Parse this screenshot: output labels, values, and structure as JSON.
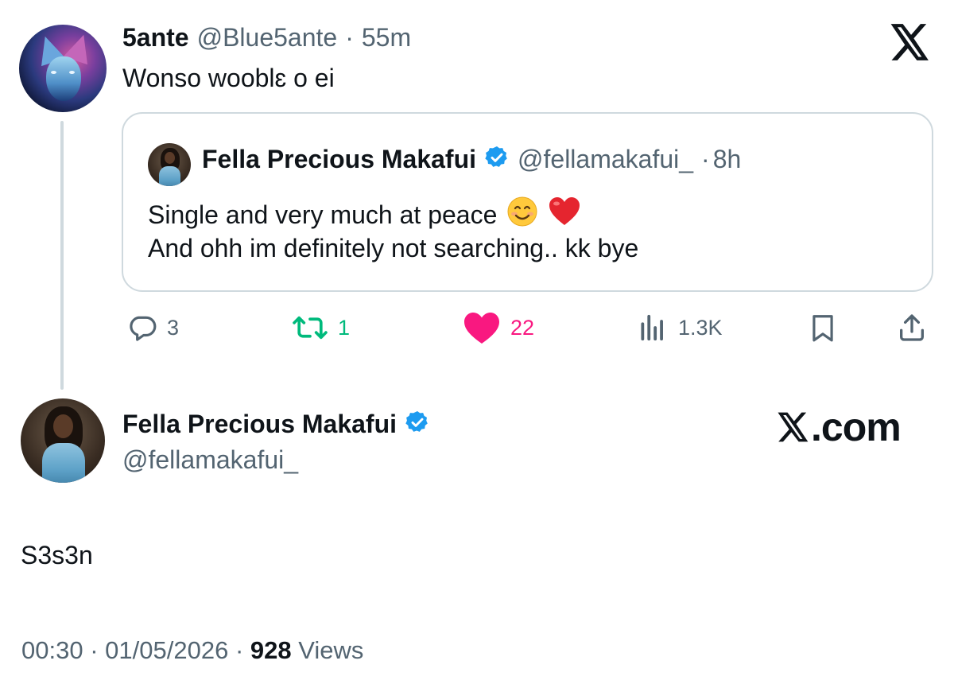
{
  "tweet": {
    "author_name": "5ante",
    "author_handle": "@Blue5ante",
    "separator": "·",
    "time": "55m",
    "text": "Wonso wooblɛ o ei"
  },
  "quoted_tweet": {
    "author_name": "Fella Precious Makafui",
    "author_handle": "@fellamakafui_",
    "separator": "·",
    "time": "8h",
    "line1": "Single and very much at peace",
    "line2": "And ohh im definitely not searching.. kk bye",
    "emojis": [
      "smiling-face-emoji",
      "red-heart-emoji"
    ]
  },
  "actions": {
    "replies": "3",
    "reposts": "1",
    "likes": "22",
    "views": "1.3K"
  },
  "reply": {
    "author_name": "Fella Precious Makafui",
    "author_handle": "@fellamakafui_",
    "text": "S3s3n"
  },
  "branding": {
    "logo": "x-logo",
    "site": ".com"
  },
  "footer": {
    "time": "00:30",
    "separator": "·",
    "date": "01/05/2026",
    "views_count": "928",
    "views_label": "Views"
  },
  "colors": {
    "verified": "#1d9bf0",
    "repost": "#00ba7c",
    "like": "#f91880",
    "muted": "#536471",
    "text": "#0f1419",
    "border": "#cfd9de"
  }
}
